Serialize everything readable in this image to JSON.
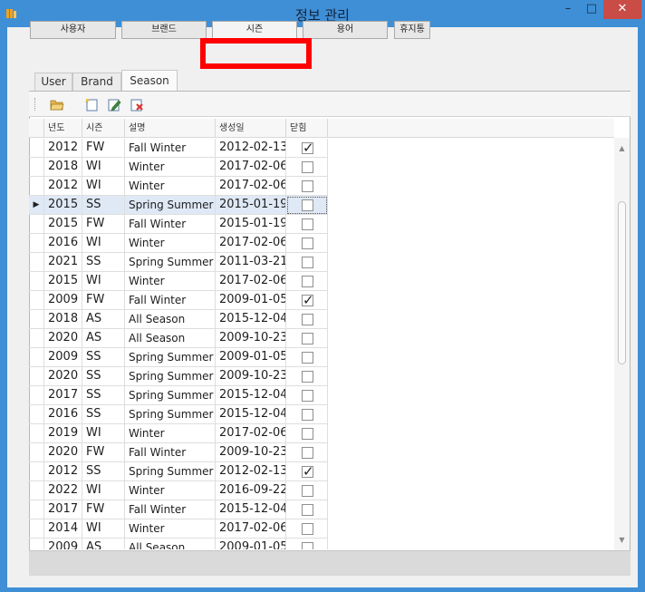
{
  "window": {
    "title": "정보 관리",
    "minimize": "–",
    "maximize": "□",
    "close": "✕"
  },
  "top_buttons": [
    {
      "label": "사용자"
    },
    {
      "label": "브랜드"
    },
    {
      "label": "시즌"
    },
    {
      "label": "용어"
    },
    {
      "label": "휴지통"
    }
  ],
  "tabs": [
    {
      "label": "User"
    },
    {
      "label": "Brand"
    },
    {
      "label": "Season",
      "active": true
    }
  ],
  "toolbar": {
    "icons": [
      "open-folder-icon",
      "new-item-icon",
      "edit-icon",
      "delete-icon"
    ]
  },
  "grid": {
    "columns": [
      "년도",
      "시즌",
      "설명",
      "생성일",
      "닫힘"
    ],
    "selected_index": 3,
    "rows": [
      {
        "year": "2012",
        "season": "FW",
        "desc": "Fall Winter",
        "created": "2012-02-13",
        "closed": true
      },
      {
        "year": "2018",
        "season": "WI",
        "desc": "Winter",
        "created": "2017-02-06",
        "closed": false
      },
      {
        "year": "2012",
        "season": "WI",
        "desc": "Winter",
        "created": "2017-02-06",
        "closed": false
      },
      {
        "year": "2015",
        "season": "SS",
        "desc": "Spring Summer",
        "created": "2015-01-19",
        "closed": false
      },
      {
        "year": "2015",
        "season": "FW",
        "desc": "Fall Winter",
        "created": "2015-01-19",
        "closed": false
      },
      {
        "year": "2016",
        "season": "WI",
        "desc": "Winter",
        "created": "2017-02-06",
        "closed": false
      },
      {
        "year": "2021",
        "season": "SS",
        "desc": "Spring Summer",
        "created": "2011-03-21",
        "closed": false
      },
      {
        "year": "2015",
        "season": "WI",
        "desc": "Winter",
        "created": "2017-02-06",
        "closed": false
      },
      {
        "year": "2009",
        "season": "FW",
        "desc": "Fall Winter",
        "created": "2009-01-05",
        "closed": true
      },
      {
        "year": "2018",
        "season": "AS",
        "desc": "All Season",
        "created": "2015-12-04",
        "closed": false
      },
      {
        "year": "2020",
        "season": "AS",
        "desc": "All Season",
        "created": "2009-10-23",
        "closed": false
      },
      {
        "year": "2009",
        "season": "SS",
        "desc": "Spring Summer",
        "created": "2009-01-05",
        "closed": false
      },
      {
        "year": "2020",
        "season": "SS",
        "desc": "Spring Summer",
        "created": "2009-10-23",
        "closed": false
      },
      {
        "year": "2017",
        "season": "SS",
        "desc": "Spring Summer",
        "created": "2015-12-04",
        "closed": false
      },
      {
        "year": "2016",
        "season": "SS",
        "desc": "Spring Summer",
        "created": "2015-12-04",
        "closed": false
      },
      {
        "year": "2019",
        "season": "WI",
        "desc": "Winter",
        "created": "2017-02-06",
        "closed": false
      },
      {
        "year": "2020",
        "season": "FW",
        "desc": "Fall Winter",
        "created": "2009-10-23",
        "closed": false
      },
      {
        "year": "2012",
        "season": "SS",
        "desc": "Spring Summer",
        "created": "2012-02-13",
        "closed": true
      },
      {
        "year": "2022",
        "season": "WI",
        "desc": "Winter",
        "created": "2016-09-22",
        "closed": false
      },
      {
        "year": "2017",
        "season": "FW",
        "desc": "Fall Winter",
        "created": "2015-12-04",
        "closed": false
      },
      {
        "year": "2014",
        "season": "WI",
        "desc": "Winter",
        "created": "2017-02-06",
        "closed": false
      },
      {
        "year": "2009",
        "season": "AS",
        "desc": "All Season",
        "created": "2009-01-05",
        "closed": false
      }
    ]
  },
  "colors": {
    "title_bar": "#3f8fd6",
    "highlight": "#ff0000",
    "close_button": "#c94c47",
    "selected_row": "#dfe9f6"
  }
}
